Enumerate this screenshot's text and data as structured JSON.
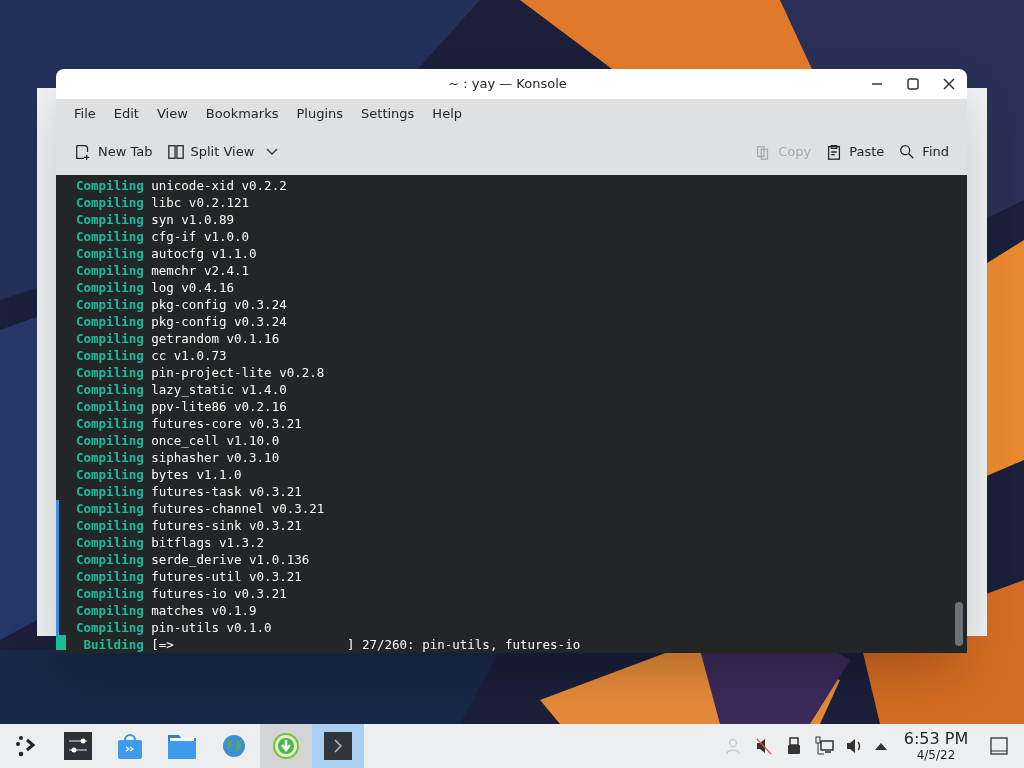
{
  "window": {
    "title": "~ : yay — Konsole"
  },
  "menu": [
    "File",
    "Edit",
    "View",
    "Bookmarks",
    "Plugins",
    "Settings",
    "Help"
  ],
  "toolbar": [
    {
      "label": "New Tab",
      "kind": "new-tab",
      "disabled": false
    },
    {
      "label": "Split View",
      "kind": "split",
      "disabled": false
    },
    {
      "label": "Copy",
      "kind": "copy",
      "disabled": true
    },
    {
      "label": "Paste",
      "kind": "paste",
      "disabled": false
    },
    {
      "label": "Find",
      "kind": "find",
      "disabled": false
    }
  ],
  "terminal": {
    "lines": [
      {
        "status": "Compiling",
        "text": "unicode-xid v0.2.2"
      },
      {
        "status": "Compiling",
        "text": "libc v0.2.121"
      },
      {
        "status": "Compiling",
        "text": "syn v1.0.89"
      },
      {
        "status": "Compiling",
        "text": "cfg-if v1.0.0"
      },
      {
        "status": "Compiling",
        "text": "autocfg v1.1.0"
      },
      {
        "status": "Compiling",
        "text": "memchr v2.4.1"
      },
      {
        "status": "Compiling",
        "text": "log v0.4.16"
      },
      {
        "status": "Compiling",
        "text": "pkg-config v0.3.24"
      },
      {
        "status": "Compiling",
        "text": "pkg-config v0.3.24"
      },
      {
        "status": "Compiling",
        "text": "getrandom v0.1.16"
      },
      {
        "status": "Compiling",
        "text": "cc v1.0.73"
      },
      {
        "status": "Compiling",
        "text": "pin-project-lite v0.2.8"
      },
      {
        "status": "Compiling",
        "text": "lazy_static v1.4.0"
      },
      {
        "status": "Compiling",
        "text": "ppv-lite86 v0.2.16"
      },
      {
        "status": "Compiling",
        "text": "futures-core v0.3.21"
      },
      {
        "status": "Compiling",
        "text": "once_cell v1.10.0"
      },
      {
        "status": "Compiling",
        "text": "siphasher v0.3.10"
      },
      {
        "status": "Compiling",
        "text": "bytes v1.1.0"
      },
      {
        "status": "Compiling",
        "text": "futures-task v0.3.21"
      },
      {
        "status": "Compiling",
        "text": "futures-channel v0.3.21"
      },
      {
        "status": "Compiling",
        "text": "futures-sink v0.3.21"
      },
      {
        "status": "Compiling",
        "text": "bitflags v1.3.2"
      },
      {
        "status": "Compiling",
        "text": "serde_derive v1.0.136"
      },
      {
        "status": "Compiling",
        "text": "futures-util v0.3.21"
      },
      {
        "status": "Compiling",
        "text": "futures-io v0.3.21"
      },
      {
        "status": "Compiling",
        "text": "matches v0.1.9"
      },
      {
        "status": "Compiling",
        "text": "pin-utils v0.1.0"
      },
      {
        "status": "Building",
        "text": "[=>                       ] 27/260: pin-utils, futures-io"
      }
    ]
  },
  "taskbar": {
    "tasks": [
      {
        "kind": "launcher",
        "selected": false,
        "hovered": false
      },
      {
        "kind": "settings",
        "selected": false,
        "hovered": false
      },
      {
        "kind": "store",
        "selected": false,
        "hovered": false
      },
      {
        "kind": "files",
        "selected": false,
        "hovered": false
      },
      {
        "kind": "browser",
        "selected": false,
        "hovered": false
      },
      {
        "kind": "download",
        "selected": false,
        "hovered": true
      },
      {
        "kind": "terminal",
        "selected": true,
        "hovered": false
      }
    ],
    "time": "6:53 PM",
    "date": "4/5/22"
  }
}
